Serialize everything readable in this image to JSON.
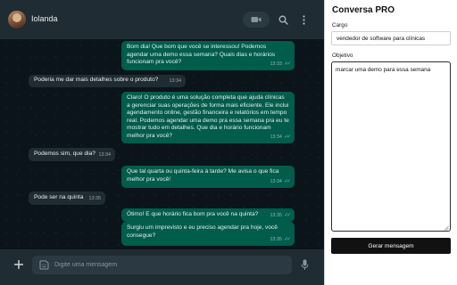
{
  "chat": {
    "contact_name": "Iolanda",
    "composer_placeholder": "Digite uma mensagem",
    "messages": [
      {
        "direction": "out",
        "text": "Bom dia! Que bom que você se interessou! Podemos agendar uma demo essa semana? Quais dias e horários funcionam pra você?",
        "time": "13:33",
        "read": true
      },
      {
        "direction": "in",
        "text": "Poderia me dar mais detalhes sobre o produto?",
        "time": "13:34"
      },
      {
        "direction": "out",
        "text": "Claro! O produto é uma solução completa que ajuda clínicas a gerenciar suas operações de forma mais eficiente. Ele inclui agendamento online, gestão financeira e relatórios em tempo real. Podemos agendar uma demo pra essa semana pra eu te mostrar tudo em detalhes. Que dia e horário funcionam melhor pra você?",
        "time": "13:34",
        "read": true
      },
      {
        "direction": "in",
        "text": "Podemos sim, que dia?",
        "time": "13:34"
      },
      {
        "direction": "out",
        "text": "Que tal quarta ou quinta-feira à tarde? Me avisa o que fica melhor pra você!",
        "time": "13:34",
        "read": true
      },
      {
        "direction": "in",
        "text": "Pode ser na quinta",
        "time": "13:35"
      },
      {
        "direction": "out",
        "text": "Ótimo! E que horário fica bom pra você na quinta?",
        "time": "13:35",
        "read": true
      },
      {
        "direction": "out",
        "text": "Surgiu um imprevisto e eu preciso agendar pra hoje, você consegue?",
        "time": "13:35",
        "read": true
      }
    ]
  },
  "panel": {
    "title": "Conversa PRO",
    "cargo_label": "Cargo",
    "cargo_value": "vendedor de software para clínicas",
    "objetivo_label": "Objetivo",
    "objetivo_value": "marcar uma demo para essa semana",
    "generate_label": "Gerar mensagem"
  },
  "icons": {
    "video": "video-camera-icon",
    "search": "search-icon",
    "menu": "kebab-menu-icon",
    "attach": "plus-icon",
    "emoji": "sticker-icon",
    "mic": "microphone-icon",
    "read_receipt": "double-check-icon"
  },
  "colors": {
    "chat_bg": "#0b141a",
    "header_bg": "#202c33",
    "outgoing_bubble": "#005c4b",
    "incoming_bubble": "#202c33",
    "read_tick": "#53bdeb",
    "primary_button": "#111111"
  }
}
